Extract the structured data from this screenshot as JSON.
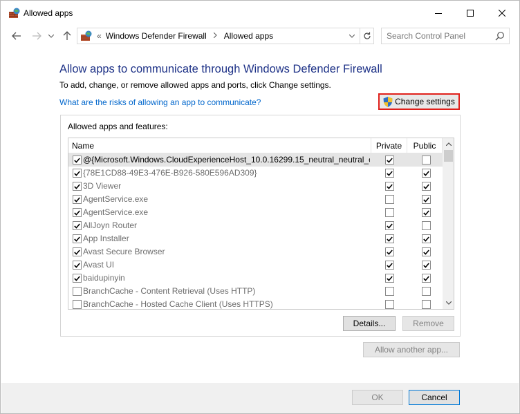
{
  "window": {
    "title": "Allowed apps"
  },
  "address": {
    "root_sep": "«",
    "crumbs": [
      "Windows Defender Firewall",
      "Allowed apps"
    ]
  },
  "search": {
    "placeholder": "Search Control Panel"
  },
  "content": {
    "heading": "Allow apps to communicate through Windows Defender Firewall",
    "subtext": "To add, change, or remove allowed apps and ports, click Change settings.",
    "risk_link": "What are the risks of allowing an app to communicate?",
    "change_settings_label": "Change settings",
    "group_label": "Allowed apps and features:"
  },
  "list": {
    "columns": {
      "name": "Name",
      "private": "Private",
      "public": "Public"
    },
    "rows": [
      {
        "name": "@{Microsoft.Windows.CloudExperienceHost_10.0.16299.15_neutral_neutral_c...",
        "enabled": true,
        "private": true,
        "public": false,
        "selected": true
      },
      {
        "name": "{78E1CD88-49E3-476E-B926-580E596AD309}",
        "enabled": true,
        "private": true,
        "public": true,
        "selected": false
      },
      {
        "name": "3D Viewer",
        "enabled": true,
        "private": true,
        "public": true,
        "selected": false
      },
      {
        "name": "AgentService.exe",
        "enabled": true,
        "private": false,
        "public": true,
        "selected": false
      },
      {
        "name": "AgentService.exe",
        "enabled": true,
        "private": false,
        "public": true,
        "selected": false
      },
      {
        "name": "AllJoyn Router",
        "enabled": true,
        "private": true,
        "public": false,
        "selected": false
      },
      {
        "name": "App Installer",
        "enabled": true,
        "private": true,
        "public": true,
        "selected": false
      },
      {
        "name": "Avast Secure Browser",
        "enabled": true,
        "private": true,
        "public": true,
        "selected": false
      },
      {
        "name": "Avast UI",
        "enabled": true,
        "private": true,
        "public": true,
        "selected": false
      },
      {
        "name": "baidupinyin",
        "enabled": true,
        "private": true,
        "public": true,
        "selected": false
      },
      {
        "name": "BranchCache - Content Retrieval (Uses HTTP)",
        "enabled": false,
        "private": false,
        "public": false,
        "selected": false
      },
      {
        "name": "BranchCache - Hosted Cache Client (Uses HTTPS)",
        "enabled": false,
        "private": false,
        "public": false,
        "selected": false
      }
    ]
  },
  "buttons": {
    "details": "Details...",
    "remove": "Remove",
    "allow_another": "Allow another app...",
    "ok": "OK",
    "cancel": "Cancel"
  },
  "colors": {
    "heading": "#1e3287",
    "link": "#0066cc",
    "highlight_border": "#e0201b"
  },
  "icons": [
    "firewall-icon",
    "shield-icon",
    "search-icon",
    "refresh-icon",
    "back-arrow-icon",
    "forward-arrow-icon",
    "up-arrow-icon"
  ]
}
